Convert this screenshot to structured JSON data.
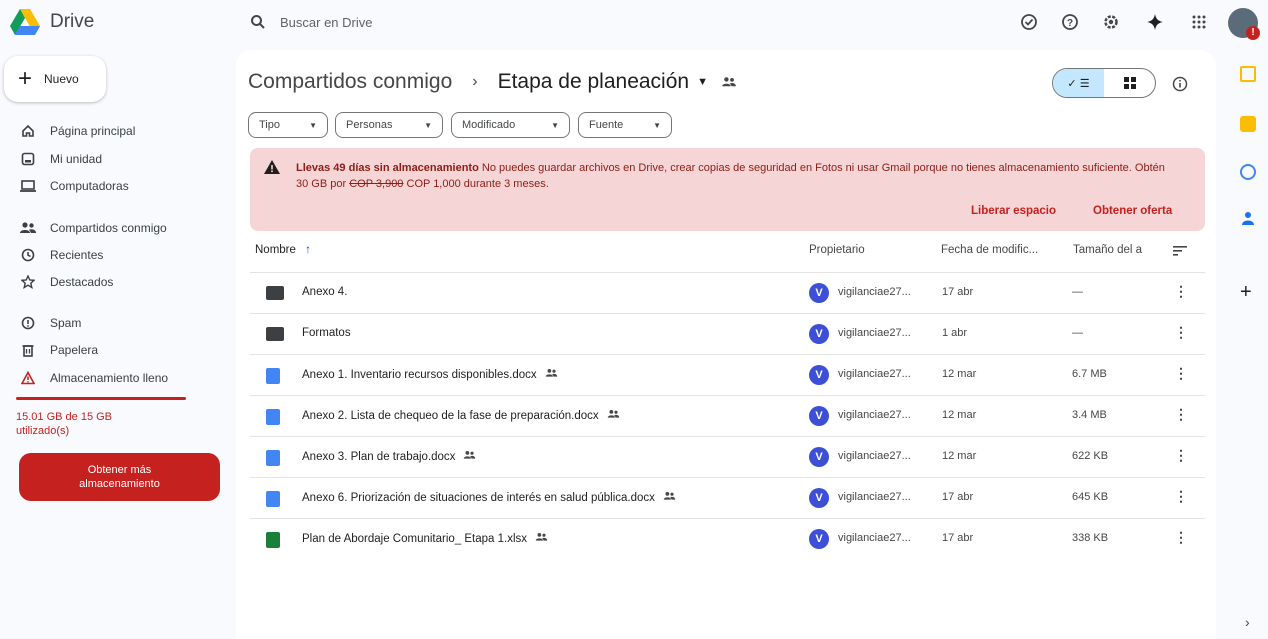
{
  "app": {
    "name": "Drive"
  },
  "search": {
    "placeholder": "Buscar en Drive"
  },
  "sidebar": {
    "new_label": "Nuevo",
    "items": [
      {
        "label": "Página principal",
        "icon": "home-icon"
      },
      {
        "label": "Mi unidad",
        "icon": "my-drive-icon"
      },
      {
        "label": "Computadoras",
        "icon": "computer-icon"
      },
      {
        "label": "Compartidos conmigo",
        "icon": "shared-icon"
      },
      {
        "label": "Recientes",
        "icon": "clock-icon"
      },
      {
        "label": "Destacados",
        "icon": "star-icon"
      },
      {
        "label": "Spam",
        "icon": "spam-icon"
      },
      {
        "label": "Papelera",
        "icon": "trash-icon"
      },
      {
        "label": "Almacenamiento lleno",
        "icon": "warning-icon"
      }
    ],
    "storage_text": "15.01 GB de 15 GB utilizado(s)",
    "storage_fraction": 1.0,
    "get_more_label": "Obtener más almacenamiento"
  },
  "breadcrumb": {
    "parent": "Compartidos conmigo",
    "current": "Etapa de planeación"
  },
  "filters": [
    "Tipo",
    "Personas",
    "Modificado",
    "Fuente"
  ],
  "banner": {
    "bold": "Llevas 49 días sin almacenamiento",
    "text": " No puedes guardar archivos en Drive, crear copias de seguridad en Fotos ni usar Gmail porque no tienes almacenamiento suficiente. Obtén 30 GB por ",
    "old_price": "COP 3,900",
    "new_price": " COP 1,000 durante 3 meses.",
    "link1": "Liberar espacio",
    "link2": "Obtener oferta"
  },
  "table": {
    "headers": {
      "name": "Nombre",
      "owner": "Propietario",
      "modified": "Fecha de modific...",
      "size": "Tamaño del a"
    },
    "rows": [
      {
        "name": "Anexo 4.",
        "type": "folder",
        "shared": false,
        "owner": "vigilanciae27...",
        "modified": "17 abr",
        "size": "—"
      },
      {
        "name": "Formatos",
        "type": "folder",
        "shared": false,
        "owner": "vigilanciae27...",
        "modified": "1 abr",
        "size": "—"
      },
      {
        "name": "Anexo 1. Inventario recursos disponibles.docx",
        "type": "doc",
        "shared": true,
        "owner": "vigilanciae27...",
        "modified": "12 mar",
        "size": "6.7 MB"
      },
      {
        "name": "Anexo 2. Lista de chequeo de la fase de preparación.docx",
        "type": "doc",
        "shared": true,
        "owner": "vigilanciae27...",
        "modified": "12 mar",
        "size": "3.4 MB"
      },
      {
        "name": "Anexo 3. Plan de trabajo.docx",
        "type": "doc",
        "shared": true,
        "owner": "vigilanciae27...",
        "modified": "12 mar",
        "size": "622 KB"
      },
      {
        "name": "Anexo 6. Priorización de situaciones de interés en salud pública.docx",
        "type": "doc",
        "shared": true,
        "owner": "vigilanciae27...",
        "modified": "17 abr",
        "size": "645 KB"
      },
      {
        "name": "Plan de Abordaje Comunitario_ Etapa 1.xlsx",
        "type": "xls",
        "shared": true,
        "owner": "vigilanciae27...",
        "modified": "17 abr",
        "size": "338 KB"
      }
    ],
    "owner_initial": "V"
  },
  "colors": {
    "alert_red": "#c5221f",
    "banner_bg": "#f5d5d5",
    "avatar_blue": "#3c4fd6"
  }
}
